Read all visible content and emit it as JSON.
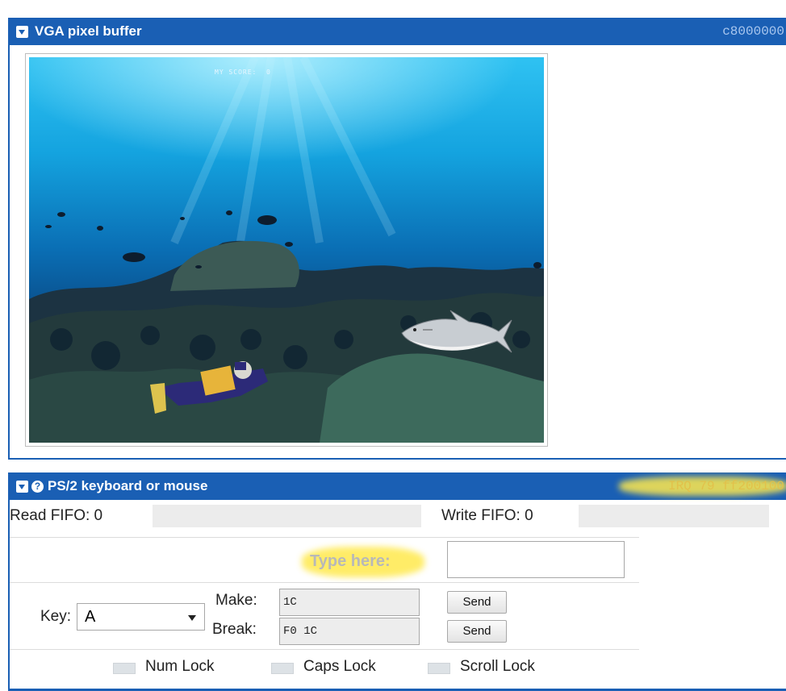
{
  "vga": {
    "title": "VGA pixel buffer",
    "address": "c8000000",
    "game": {
      "score_text": "MY SCORE:  0"
    }
  },
  "ps2": {
    "title": "PS/2 keyboard or mouse",
    "help_glyph": "?",
    "irq_address": "IRQ 79  ff200100",
    "read_fifo_label": "Read FIFO: 0",
    "write_fifo_label": "Write FIFO: 0",
    "type_here_label": "Type here:",
    "type_here_value": "",
    "key_label": "Key:",
    "key_value": "A",
    "make_label": "Make:",
    "make_value": "1C",
    "break_label": "Break:",
    "break_value": "F0 1C",
    "send_label": "Send",
    "leds": [
      "Num Lock",
      "Caps Lock",
      "Scroll Lock"
    ]
  },
  "colors": {
    "titlebar": "#1a5fb4",
    "highlight": "#ffe94d"
  },
  "icons": [
    "collapse-icon",
    "help-icon",
    "dropdown-arrow-icon"
  ]
}
